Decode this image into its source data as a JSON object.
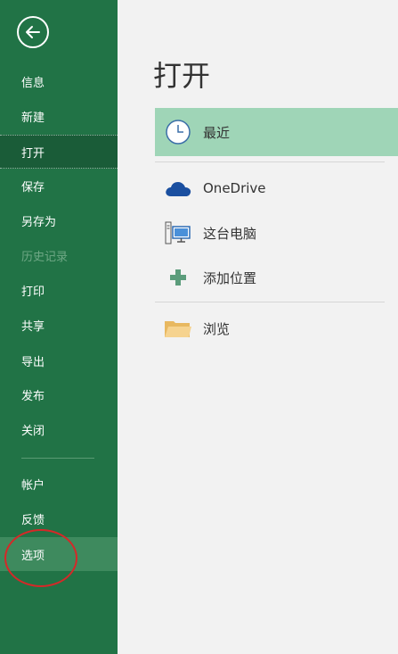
{
  "sidebar": {
    "items": [
      {
        "label": "信息"
      },
      {
        "label": "新建"
      },
      {
        "label": "打开"
      },
      {
        "label": "保存"
      },
      {
        "label": "另存为"
      },
      {
        "label": "历史记录"
      },
      {
        "label": "打印"
      },
      {
        "label": "共享"
      },
      {
        "label": "导出"
      },
      {
        "label": "发布"
      },
      {
        "label": "关闭"
      },
      {
        "label": "帐户"
      },
      {
        "label": "反馈"
      },
      {
        "label": "选项"
      }
    ]
  },
  "main": {
    "title": "打开",
    "locations": [
      {
        "label": "最近",
        "icon": "clock-icon"
      },
      {
        "label": "OneDrive",
        "icon": "cloud-icon"
      },
      {
        "label": "这台电脑",
        "icon": "computer-icon"
      },
      {
        "label": "添加位置",
        "icon": "plus-icon"
      },
      {
        "label": "浏览",
        "icon": "folder-icon"
      }
    ]
  },
  "colors": {
    "sidebar_bg": "#217346",
    "active_item_bg": "#1a5c38",
    "selected_location_bg": "#9fd5b7",
    "annotation_circle": "#d62828"
  }
}
